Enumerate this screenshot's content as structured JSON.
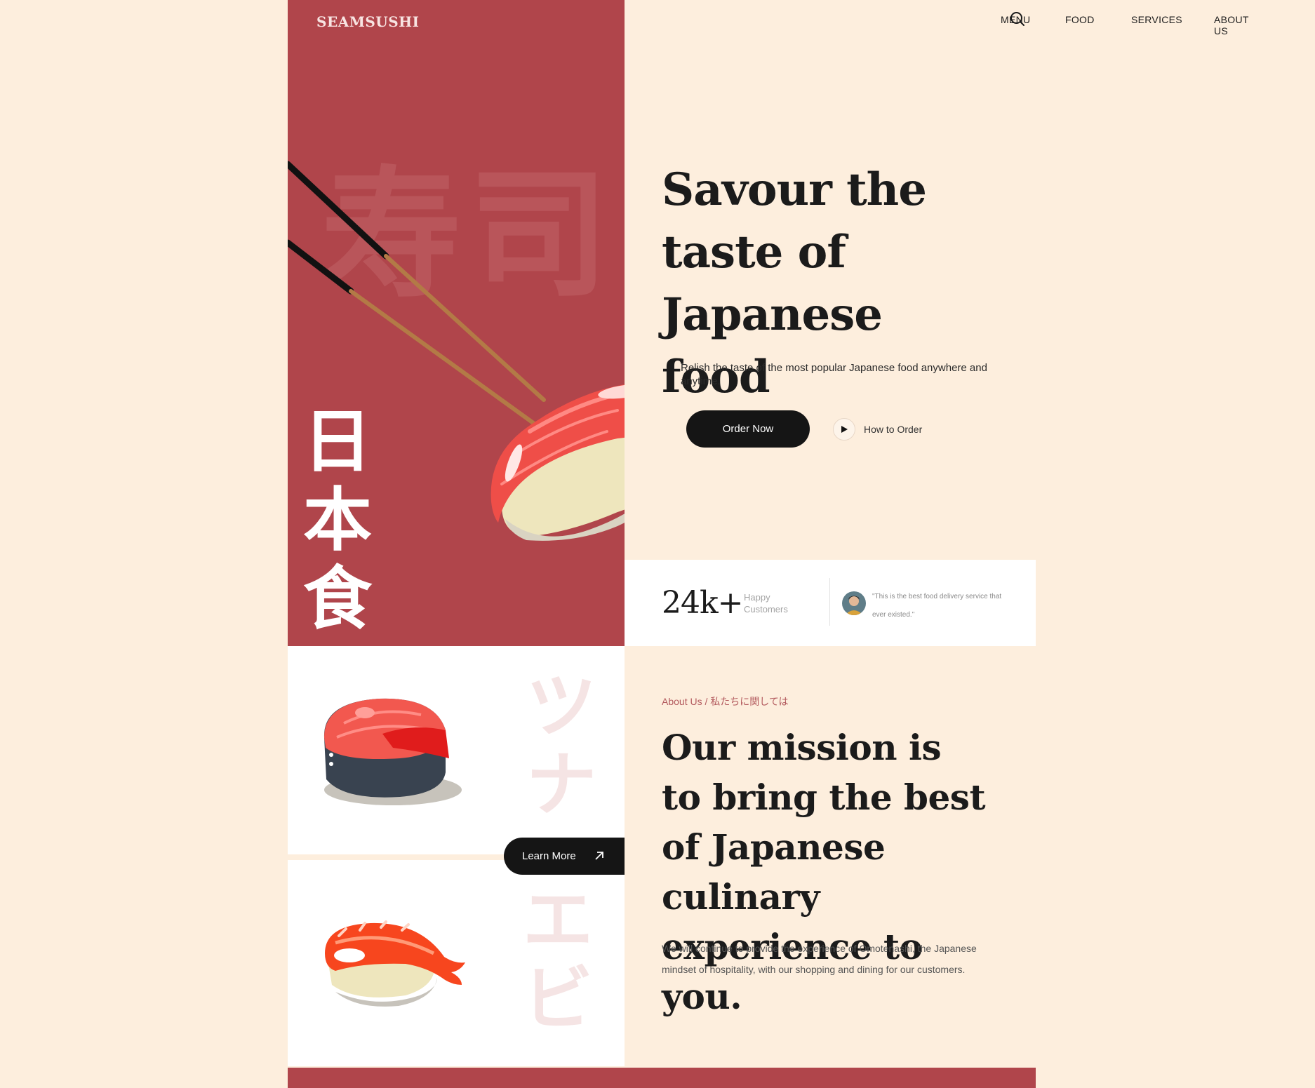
{
  "brand": {
    "logo": "SEAMSUSHI"
  },
  "nav": {
    "items": [
      {
        "label": "MENU"
      },
      {
        "label": "FOOD"
      },
      {
        "label": "SERVICES"
      },
      {
        "label": "ABOUT US"
      }
    ],
    "search_icon": "search-icon"
  },
  "hero": {
    "kanji_vertical": [
      "日",
      "本",
      "食"
    ],
    "bg_kanji": [
      "寿",
      "司"
    ],
    "title": "Savour the taste of Japanese food",
    "subtitle": "Relish the taste of the most popular Japanese food anywhere and anytime.",
    "order_button": "Order Now",
    "how_button": "How to Order"
  },
  "stats": {
    "count": "24k+",
    "count_label": "Happy Customers",
    "quote": "\"This is the best food delivery service that ever existed.\""
  },
  "showcase": {
    "top_katakana": "ツナ",
    "bottom_katakana": "エビ",
    "learn_button": "Learn More"
  },
  "about": {
    "label": "About Us / 私たちに関しては",
    "title": "Our mission is to bring the best of Japanese culinary experience to you.",
    "body": "We will continue to provide the experience of Omotenashi, the Japanese mindset of hospitality, with our shopping and dining for our customers."
  },
  "colors": {
    "accent_red": "#b0454b",
    "cream_bg": "#fdeedd",
    "dark": "#151515"
  }
}
